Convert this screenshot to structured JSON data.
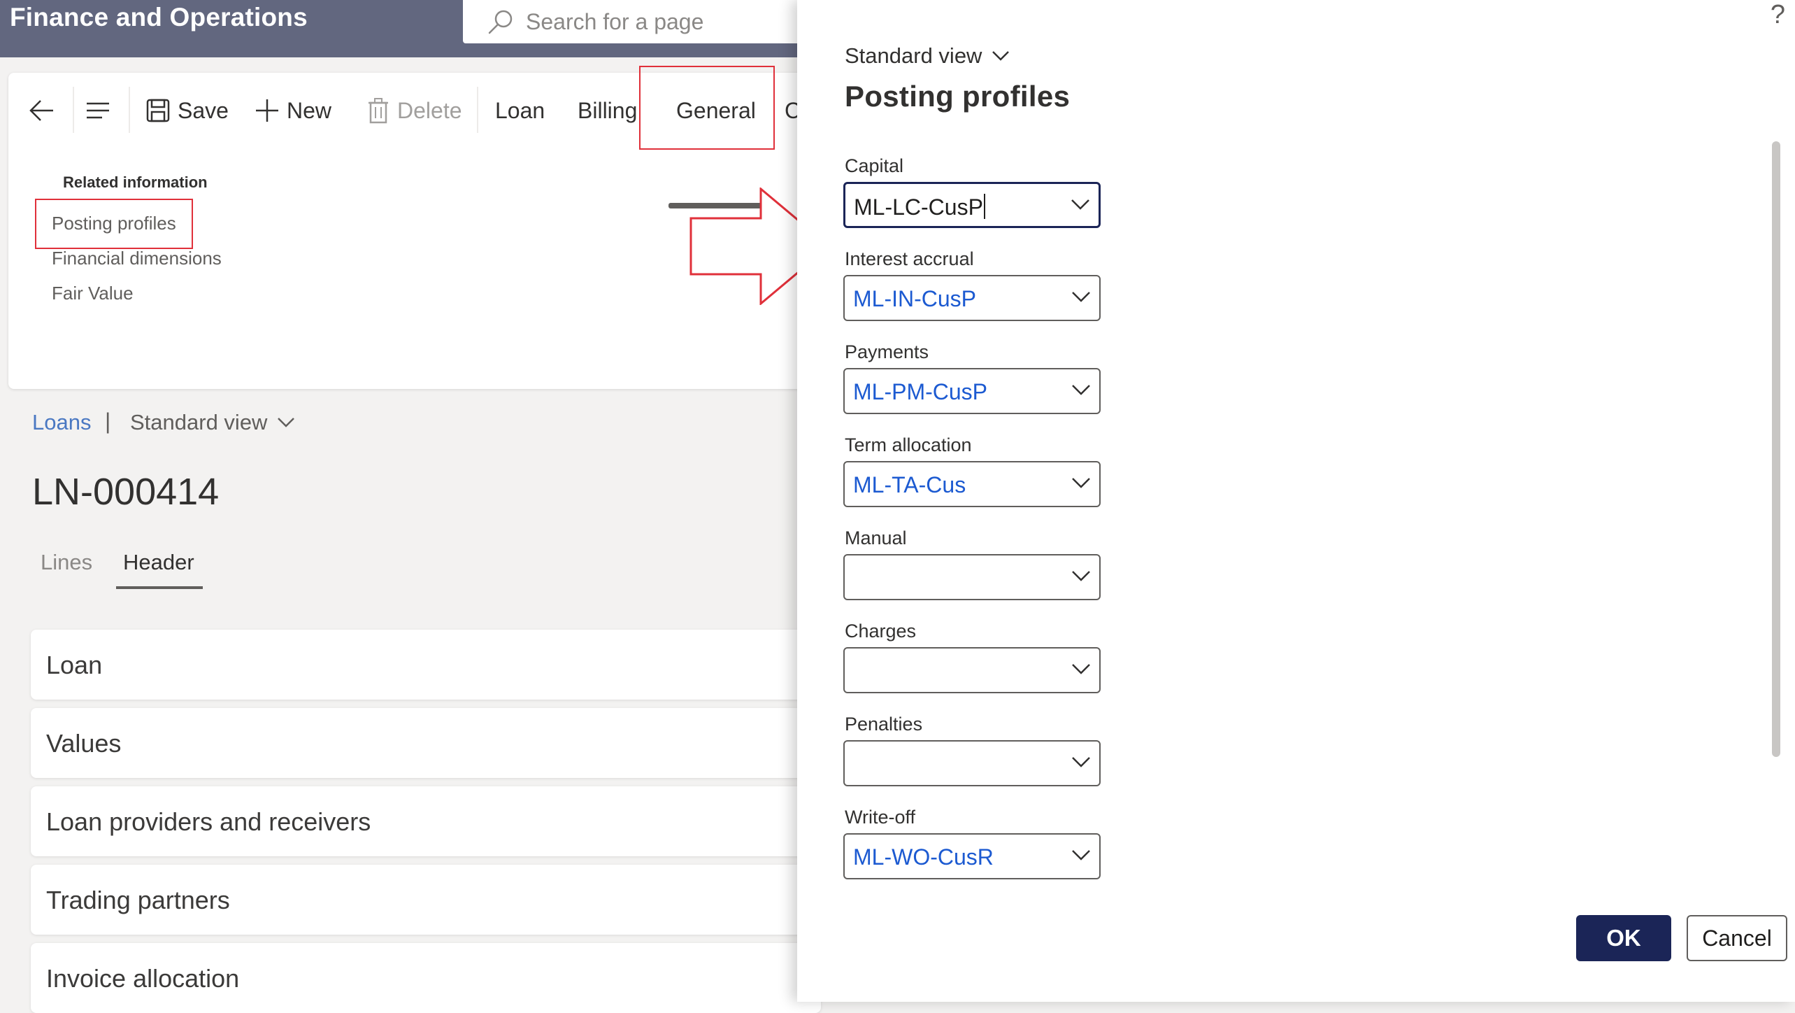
{
  "app": {
    "title": "Finance and Operations"
  },
  "search": {
    "placeholder": "Search for a page"
  },
  "action_pane": {
    "save_label": "Save",
    "new_label": "New",
    "delete_label": "Delete",
    "tabs": [
      "Loan",
      "Billing",
      "General",
      "C"
    ],
    "related_information_title": "Related information",
    "related_links": [
      "Posting profiles",
      "Financial dimensions",
      "Fair Value"
    ]
  },
  "breadcrumb": {
    "root": "Loans",
    "separator": "|",
    "view": "Standard view"
  },
  "record": {
    "id": "LN-000414"
  },
  "record_tabs": {
    "lines": "Lines",
    "header": "Header"
  },
  "fasttabs": [
    "Loan",
    "Values",
    "Loan providers and receivers",
    "Trading partners",
    "Invoice allocation"
  ],
  "panel": {
    "help": "?",
    "view": "Standard view",
    "title": "Posting profiles",
    "fields": [
      {
        "label": "Capital",
        "value": "ML-LC-CusP"
      },
      {
        "label": "Interest accrual",
        "value": "ML-IN-CusP"
      },
      {
        "label": "Payments",
        "value": "ML-PM-CusP"
      },
      {
        "label": "Term allocation",
        "value": "ML-TA-Cus"
      },
      {
        "label": "Manual",
        "value": ""
      },
      {
        "label": "Charges",
        "value": ""
      },
      {
        "label": "Penalties",
        "value": ""
      },
      {
        "label": "Write-off",
        "value": "ML-WO-CusR"
      }
    ],
    "ok_label": "OK",
    "cancel_label": "Cancel"
  },
  "colors": {
    "topbar": "#62677f",
    "primary_button": "#1b2557",
    "link": "#1c5ad1",
    "highlight_annotation": "#e0303a"
  }
}
